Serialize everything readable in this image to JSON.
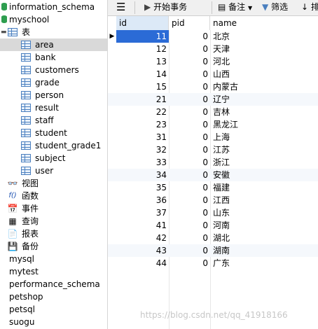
{
  "tree": {
    "databases_top": [
      "information_schema",
      "myschool"
    ],
    "tables_group": "表",
    "tables": [
      "area",
      "bank",
      "customers",
      "grade",
      "person",
      "result",
      "staff",
      "student",
      "student_grade1",
      "subject",
      "user"
    ],
    "selected_table": "area",
    "other_groups": [
      {
        "label": "视图",
        "icon": "view-icon",
        "glyph": "👓"
      },
      {
        "label": "函数",
        "icon": "function-icon",
        "glyph": "f()"
      },
      {
        "label": "事件",
        "icon": "event-icon",
        "glyph": "📅"
      },
      {
        "label": "查询",
        "icon": "query-icon",
        "glyph": "▦"
      },
      {
        "label": "报表",
        "icon": "report-icon",
        "glyph": "📄"
      },
      {
        "label": "备份",
        "icon": "backup-icon",
        "glyph": "💾"
      }
    ],
    "databases_bottom": [
      "mysql",
      "mytest",
      "performance_schema",
      "petshop",
      "petsql",
      "suogu"
    ]
  },
  "toolbar": {
    "menu_icon": "hamburger-icon",
    "begin_transaction": "开始事务",
    "memo": "备注",
    "filter": "筛选",
    "sort_partial": "排"
  },
  "grid": {
    "columns": [
      "id",
      "pid",
      "name"
    ],
    "rows": [
      {
        "id": "11",
        "pid": "0",
        "name": "北京"
      },
      {
        "id": "12",
        "pid": "0",
        "name": "天津"
      },
      {
        "id": "13",
        "pid": "0",
        "name": "河北"
      },
      {
        "id": "14",
        "pid": "0",
        "name": "山西"
      },
      {
        "id": "15",
        "pid": "0",
        "name": "内蒙古"
      },
      {
        "id": "21",
        "pid": "0",
        "name": "辽宁"
      },
      {
        "id": "22",
        "pid": "0",
        "name": "吉林"
      },
      {
        "id": "23",
        "pid": "0",
        "name": "黑龙江"
      },
      {
        "id": "31",
        "pid": "0",
        "name": "上海"
      },
      {
        "id": "32",
        "pid": "0",
        "name": "江苏"
      },
      {
        "id": "33",
        "pid": "0",
        "name": "浙江"
      },
      {
        "id": "34",
        "pid": "0",
        "name": "安徽"
      },
      {
        "id": "35",
        "pid": "0",
        "name": "福建"
      },
      {
        "id": "36",
        "pid": "0",
        "name": "江西"
      },
      {
        "id": "37",
        "pid": "0",
        "name": "山东"
      },
      {
        "id": "41",
        "pid": "0",
        "name": "河南"
      },
      {
        "id": "42",
        "pid": "0",
        "name": "湖北"
      },
      {
        "id": "43",
        "pid": "0",
        "name": "湖南"
      },
      {
        "id": "44",
        "pid": "0",
        "name": "广东"
      }
    ],
    "current_row_index": 0
  },
  "watermark": "https://blog.csdn.net/qq_41918166",
  "colors": {
    "selection": "#2b6bd6",
    "header_highlight": "#dce9f7",
    "db_icon": "#2e9e4f",
    "table_icon": "#4a7fbf"
  }
}
